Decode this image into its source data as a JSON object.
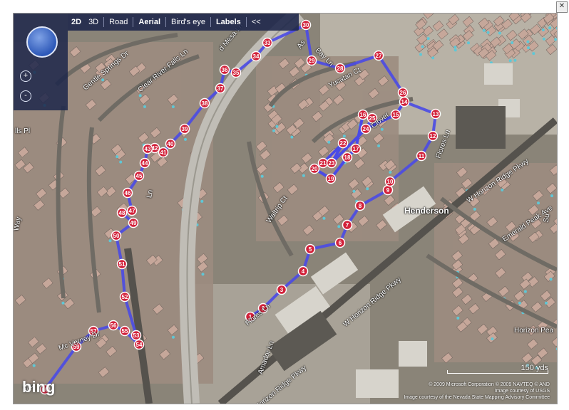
{
  "toolbar": {
    "mode_2d": "2D",
    "mode_3d": "3D",
    "road": "Road",
    "aerial": "Aerial",
    "birds_eye": "Bird's eye",
    "labels": "Labels",
    "collapse": "<<"
  },
  "nav": {
    "zoom_in": "+",
    "zoom_out": "-"
  },
  "streets": [
    {
      "name": "Gentle Springs Dr"
    },
    {
      "name": "Clear River Falls Ln"
    },
    {
      "name": "d Mesa Ln"
    },
    {
      "name": "As"
    },
    {
      "name": "Bay Ln"
    },
    {
      "name": "Yucatan Ct"
    },
    {
      "name": "Clover"
    },
    {
      "name": "Flores Ln"
    },
    {
      "name": "W Horizon Ridge Pkwy"
    },
    {
      "name": "Emerald Peak Ave"
    },
    {
      "name": "Horizon Pea"
    },
    {
      "name": "W Horizon Ridge Pkwy"
    },
    {
      "name": "Waltrip Ct"
    },
    {
      "name": "Flores Ln"
    },
    {
      "name": "Amador Ln"
    },
    {
      "name": "Horizon Ridge Pkwy"
    },
    {
      "name": "Mc Verney Dr"
    },
    {
      "name": "Mc"
    },
    {
      "name": "Way"
    },
    {
      "name": "lls Pl"
    },
    {
      "name": "Ln"
    },
    {
      "name": "Su"
    }
  ],
  "city_label": "Henderson",
  "scale_label": "150 yds",
  "logo_text": "bing",
  "copyright_lines": [
    "© 2009 Microsoft Corporation   © 2009 NAVTEQ   © AND",
    "Image courtesy of USGS",
    "Image courtesy of the Nevada State Mapping Advisory Committee"
  ],
  "route": {
    "color": "#4a4ae6",
    "marker_color": "#d2213a",
    "waypoints": [
      "1",
      "2",
      "3",
      "4",
      "5",
      "6",
      "7",
      "8",
      "9",
      "10",
      "11",
      "12",
      "13",
      "14",
      "15",
      "16",
      "17",
      "18",
      "19",
      "20",
      "21",
      "22",
      "23",
      "24",
      "25",
      "26",
      "27",
      "28",
      "29",
      "30",
      "33",
      "34",
      "35",
      "36",
      "37",
      "38",
      "39",
      "40",
      "41",
      "42",
      "43",
      "44",
      "45",
      "46",
      "47",
      "48",
      "49",
      "50",
      "51",
      "52",
      "53",
      "54",
      "55",
      "56",
      "57",
      "59",
      "60"
    ]
  }
}
